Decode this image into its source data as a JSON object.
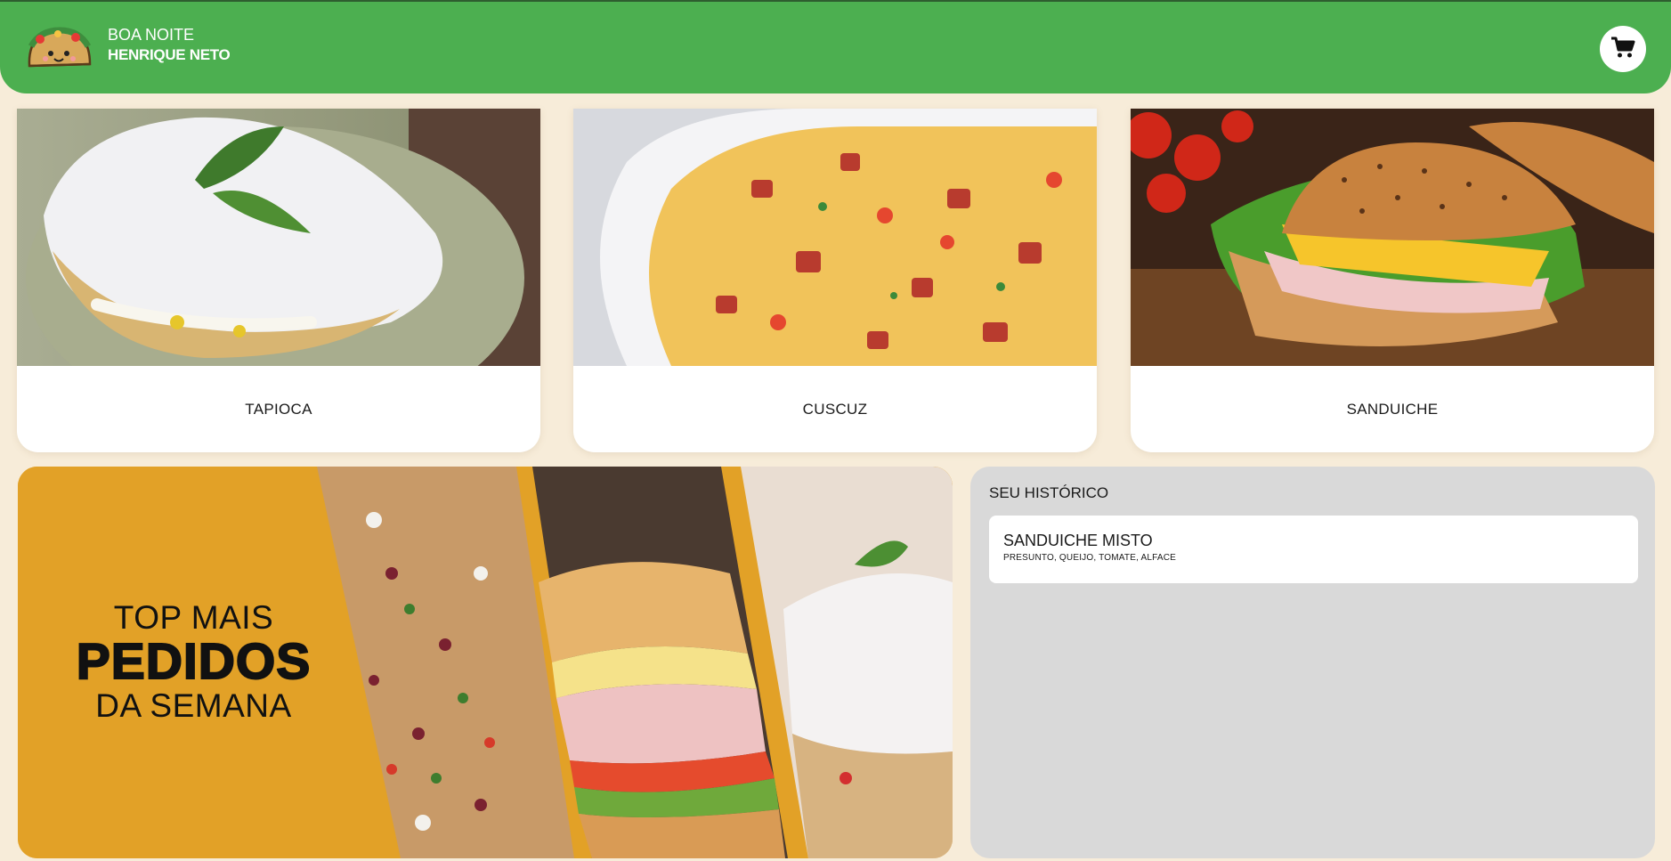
{
  "header": {
    "greeting": "BOA NOITE",
    "username": "HENRIQUE NETO",
    "logo_icon": "taco-mascot-icon",
    "cart_icon": "shopping-cart-icon"
  },
  "categories": [
    {
      "label": "TAPIOCA"
    },
    {
      "label": "CUSCUZ"
    },
    {
      "label": "SANDUICHE"
    }
  ],
  "banner": {
    "line1": "TOP MAIS",
    "line2": "PEDIDOS",
    "line3": "DA SEMANA"
  },
  "history": {
    "title": "SEU HISTÓRICO",
    "items": [
      {
        "name": "SANDUICHE MISTO",
        "description": "PRESUNTO, QUEIJO, TOMATE, ALFACE"
      }
    ]
  },
  "colors": {
    "header": "#4caf50",
    "background": "#f7ecd9",
    "banner": "#e2a127",
    "panel": "#d9d9d9"
  }
}
